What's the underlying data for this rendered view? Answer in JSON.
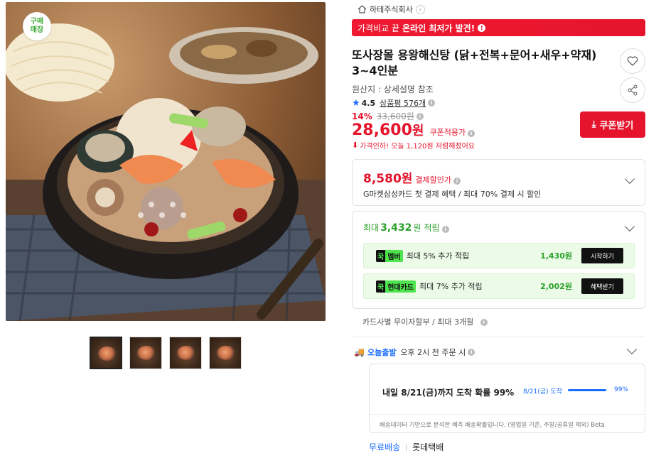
{
  "image": {
    "badge": "구매\n매장"
  },
  "seller": {
    "name": "하테주식회사"
  },
  "banner": {
    "prefix": "가격비교 끝",
    "highlight": "온라인 최저가 발견!"
  },
  "product": {
    "title": "또사장몰 용왕해신탕 (닭+전복+문어+새우+약재) 3~4인분",
    "origin": "원산지 : 상세설명 참조",
    "rating": "4.5",
    "reviews": "상품평 576개",
    "discount_pct": "14%",
    "original_price": "33,600원",
    "price": "28,600",
    "price_unit": "원",
    "coupon_note": "쿠폰적용가",
    "price_drop": "가격인하! 오늘 1,120원 저렴해졌어요",
    "coupon_button": "쿠폰받기"
  },
  "payment": {
    "amount": "8,580원",
    "label": "결제할인가",
    "desc": "G마켓삼성카드 첫 결제 혜택 / 최대 70% 결제 시 할인"
  },
  "points": {
    "prefix": "최대",
    "amount": "3,432",
    "unit": "원",
    "suffix": "적립",
    "benefits": [
      {
        "tag_k": "꾹",
        "tag_n": "멤버",
        "text": "최대 5% 추가 적립",
        "amount": "1,430원",
        "button": "시작하기"
      },
      {
        "tag_k": "꾹",
        "tag_n": "현대카드",
        "text": "최대 7% 추가 적립",
        "amount": "2,002원",
        "button": "혜택받기"
      }
    ]
  },
  "installment": "카드사별 무이자할부 / 최대 3개월",
  "delivery": {
    "brand": "오늘출발",
    "text": "오후 2시 전 주문 시",
    "eta_main": "내일 8/21(금)까지 도착 확률 99%",
    "eta_mini": "8/21(금) 도착",
    "eta_pct": "99%",
    "eta_fill": 0.99,
    "foot": "배송데이터 기반으로 분석한 예측 배송확률입니다. (영업일 기준, 주말/공휴일 제외) Beta",
    "free": "무료배송",
    "carrier": "롯데택배"
  },
  "colors": {
    "accent_red": "#e5142c",
    "accent_green": "#2aa12a",
    "accent_blue": "#1a6dff"
  }
}
